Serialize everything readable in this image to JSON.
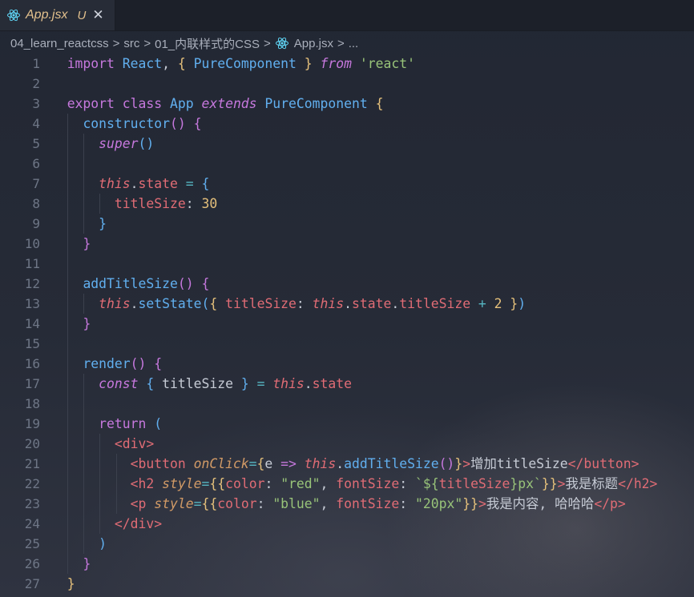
{
  "tab": {
    "filename": "App.jsx",
    "status": "U",
    "close_glyph": "✕",
    "icon": "react-icon"
  },
  "breadcrumb": {
    "items": [
      "04_learn_reactcss",
      "src",
      "01_内联样式的CSS",
      "App.jsx",
      "..."
    ],
    "separator": ">"
  },
  "colors": {
    "background": "#252a35",
    "keyword": "#c678dd",
    "class": "#61afef",
    "string": "#98c379",
    "number": "#e5c07b",
    "property": "#e06c75",
    "attribute": "#d19a66",
    "operator": "#56b6c2",
    "tab_modified": "#e2c08d"
  },
  "editor": {
    "lines": [
      {
        "n": "1",
        "indent": 0,
        "t": [
          [
            "import ",
            "kw"
          ],
          [
            "React",
            "cls"
          ],
          [
            ", ",
            "plain"
          ],
          [
            "{",
            "br1"
          ],
          [
            " ",
            "plain"
          ],
          [
            "PureComponent",
            "cls"
          ],
          [
            " ",
            "plain"
          ],
          [
            "}",
            "br1"
          ],
          [
            " ",
            "plain"
          ],
          [
            "from",
            "kwi"
          ],
          [
            " ",
            "plain"
          ],
          [
            "'react'",
            "str"
          ]
        ]
      },
      {
        "n": "2",
        "indent": 0,
        "t": []
      },
      {
        "n": "3",
        "indent": 0,
        "t": [
          [
            "export ",
            "kw"
          ],
          [
            "class ",
            "kw"
          ],
          [
            "App ",
            "cls"
          ],
          [
            "extends ",
            "kwi"
          ],
          [
            "PureComponent ",
            "cls"
          ],
          [
            "{",
            "br1"
          ]
        ]
      },
      {
        "n": "4",
        "indent": 1,
        "t": [
          [
            "  ",
            "plain"
          ],
          [
            "constructor",
            "fn"
          ],
          [
            "()",
            "br2"
          ],
          [
            " ",
            "plain"
          ],
          [
            "{",
            "br2"
          ]
        ]
      },
      {
        "n": "5",
        "indent": 2,
        "t": [
          [
            "    ",
            "plain"
          ],
          [
            "super",
            "kwi"
          ],
          [
            "()",
            "br3"
          ]
        ]
      },
      {
        "n": "6",
        "indent": 2,
        "t": []
      },
      {
        "n": "7",
        "indent": 2,
        "t": [
          [
            "    ",
            "plain"
          ],
          [
            "this",
            "thisi"
          ],
          [
            ".",
            "plain"
          ],
          [
            "state",
            "prop"
          ],
          [
            " = ",
            "op"
          ],
          [
            "{",
            "br3"
          ]
        ]
      },
      {
        "n": "8",
        "indent": 3,
        "t": [
          [
            "      ",
            "plain"
          ],
          [
            "titleSize",
            "prop"
          ],
          [
            ": ",
            "plain"
          ],
          [
            "30",
            "num"
          ]
        ]
      },
      {
        "n": "9",
        "indent": 2,
        "t": [
          [
            "    ",
            "plain"
          ],
          [
            "}",
            "br3"
          ]
        ]
      },
      {
        "n": "10",
        "indent": 1,
        "t": [
          [
            "  ",
            "plain"
          ],
          [
            "}",
            "br2"
          ]
        ]
      },
      {
        "n": "11",
        "indent": 1,
        "t": []
      },
      {
        "n": "12",
        "indent": 1,
        "t": [
          [
            "  ",
            "plain"
          ],
          [
            "addTitleSize",
            "fn"
          ],
          [
            "()",
            "br2"
          ],
          [
            " ",
            "plain"
          ],
          [
            "{",
            "br2"
          ]
        ]
      },
      {
        "n": "13",
        "indent": 2,
        "t": [
          [
            "    ",
            "plain"
          ],
          [
            "this",
            "thisi"
          ],
          [
            ".",
            "plain"
          ],
          [
            "setState",
            "fn"
          ],
          [
            "(",
            "br3"
          ],
          [
            "{",
            "br1"
          ],
          [
            " ",
            "plain"
          ],
          [
            "titleSize",
            "prop"
          ],
          [
            ": ",
            "plain"
          ],
          [
            "this",
            "thisi"
          ],
          [
            ".",
            "plain"
          ],
          [
            "state",
            "prop"
          ],
          [
            ".",
            "plain"
          ],
          [
            "titleSize",
            "prop"
          ],
          [
            " + ",
            "op"
          ],
          [
            "2",
            "num"
          ],
          [
            " ",
            "plain"
          ],
          [
            "}",
            "br1"
          ],
          [
            ")",
            "br3"
          ]
        ]
      },
      {
        "n": "14",
        "indent": 1,
        "t": [
          [
            "  ",
            "plain"
          ],
          [
            "}",
            "br2"
          ]
        ]
      },
      {
        "n": "15",
        "indent": 1,
        "t": []
      },
      {
        "n": "16",
        "indent": 1,
        "t": [
          [
            "  ",
            "plain"
          ],
          [
            "render",
            "fn"
          ],
          [
            "()",
            "br2"
          ],
          [
            " ",
            "plain"
          ],
          [
            "{",
            "br2"
          ]
        ]
      },
      {
        "n": "17",
        "indent": 2,
        "t": [
          [
            "    ",
            "plain"
          ],
          [
            "const ",
            "kwi"
          ],
          [
            "{",
            "br3"
          ],
          [
            " titleSize ",
            "plain"
          ],
          [
            "}",
            "br3"
          ],
          [
            " = ",
            "op"
          ],
          [
            "this",
            "thisi"
          ],
          [
            ".",
            "plain"
          ],
          [
            "state",
            "prop"
          ]
        ]
      },
      {
        "n": "18",
        "indent": 2,
        "t": []
      },
      {
        "n": "19",
        "indent": 2,
        "t": [
          [
            "    ",
            "plain"
          ],
          [
            "return ",
            "kw"
          ],
          [
            "(",
            "br3"
          ]
        ]
      },
      {
        "n": "20",
        "indent": 3,
        "t": [
          [
            "      ",
            "plain"
          ],
          [
            "<div>",
            "tag"
          ]
        ]
      },
      {
        "n": "21",
        "indent": 4,
        "t": [
          [
            "        ",
            "plain"
          ],
          [
            "<button ",
            "tag"
          ],
          [
            "onClick",
            "attr"
          ],
          [
            "=",
            "op"
          ],
          [
            "{",
            "br1"
          ],
          [
            "e",
            "plain"
          ],
          [
            " => ",
            "kw"
          ],
          [
            "this",
            "thisi"
          ],
          [
            ".",
            "plain"
          ],
          [
            "addTitleSize",
            "fn"
          ],
          [
            "()",
            "br2"
          ],
          [
            "}",
            "br1"
          ],
          [
            ">",
            "tag"
          ],
          [
            "增加titleSize",
            "plain"
          ],
          [
            "</button>",
            "tag"
          ]
        ]
      },
      {
        "n": "22",
        "indent": 4,
        "t": [
          [
            "        ",
            "plain"
          ],
          [
            "<h2 ",
            "tag"
          ],
          [
            "style",
            "attr"
          ],
          [
            "=",
            "op"
          ],
          [
            "{{",
            "br1"
          ],
          [
            "color",
            "prop"
          ],
          [
            ": ",
            "plain"
          ],
          [
            "\"red\"",
            "str"
          ],
          [
            ", ",
            "plain"
          ],
          [
            "fontSize",
            "prop"
          ],
          [
            ": ",
            "plain"
          ],
          [
            "`${",
            "str"
          ],
          [
            "titleSize",
            "prop"
          ],
          [
            "}px`",
            "str"
          ],
          [
            "}}",
            "br1"
          ],
          [
            ">",
            "tag"
          ],
          [
            "我是标题",
            "plain"
          ],
          [
            "</h2>",
            "tag"
          ]
        ]
      },
      {
        "n": "23",
        "indent": 4,
        "t": [
          [
            "        ",
            "plain"
          ],
          [
            "<p ",
            "tag"
          ],
          [
            "style",
            "attr"
          ],
          [
            "=",
            "op"
          ],
          [
            "{{",
            "br1"
          ],
          [
            "color",
            "prop"
          ],
          [
            ": ",
            "plain"
          ],
          [
            "\"blue\"",
            "str"
          ],
          [
            ", ",
            "plain"
          ],
          [
            "fontSize",
            "prop"
          ],
          [
            ": ",
            "plain"
          ],
          [
            "\"20px\"",
            "str"
          ],
          [
            "}}",
            "br1"
          ],
          [
            ">",
            "tag"
          ],
          [
            "我是内容, 哈哈哈",
            "plain"
          ],
          [
            "</p>",
            "tag"
          ]
        ]
      },
      {
        "n": "24",
        "indent": 3,
        "t": [
          [
            "      ",
            "plain"
          ],
          [
            "</div>",
            "tag"
          ]
        ]
      },
      {
        "n": "25",
        "indent": 2,
        "t": [
          [
            "    ",
            "plain"
          ],
          [
            ")",
            "br3"
          ]
        ]
      },
      {
        "n": "26",
        "indent": 1,
        "t": [
          [
            "  ",
            "plain"
          ],
          [
            "}",
            "br2"
          ]
        ]
      },
      {
        "n": "27",
        "indent": 0,
        "t": [
          [
            "}",
            "br1"
          ]
        ]
      }
    ]
  }
}
